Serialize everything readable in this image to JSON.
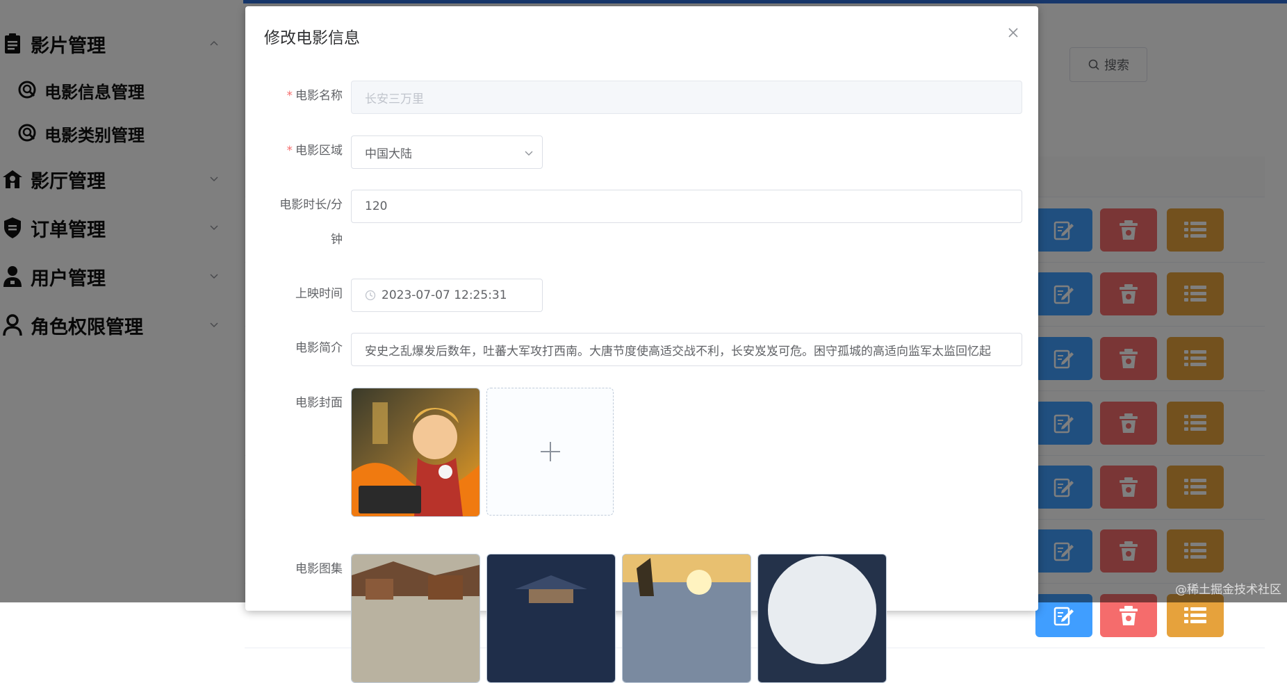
{
  "sidebar": {
    "menus": [
      {
        "label": "影片管理",
        "icon": "document-list-icon",
        "expanded": true
      },
      {
        "label": "影厅管理",
        "icon": "building-icon",
        "expanded": false
      },
      {
        "label": "订单管理",
        "icon": "shield-icon",
        "expanded": false
      },
      {
        "label": "用户管理",
        "icon": "user-badge-icon",
        "expanded": false
      },
      {
        "label": "角色权限管理",
        "icon": "user-icon",
        "expanded": false
      }
    ],
    "sub_items": [
      {
        "label": "电影信息管理",
        "icon": "search-circle-icon"
      },
      {
        "label": "电影类别管理",
        "icon": "search-circle-icon"
      }
    ]
  },
  "main": {
    "search_label": "搜索"
  },
  "dialog": {
    "title": "修改电影信息",
    "fields": {
      "name": {
        "label": "电影名称",
        "required": true,
        "value": "长安三万里"
      },
      "region": {
        "label": "电影区域",
        "required": true,
        "value": "中国大陆"
      },
      "duration": {
        "label_line1": "电影时长/分",
        "label_line2": "钟",
        "value": "120"
      },
      "release": {
        "label": "上映时间",
        "value": "2023-07-07 12:25:31"
      },
      "intro": {
        "label": "电影简介",
        "value": "安史之乱爆发后数年，吐蕃大军攻打西南。大唐节度使高适交战不利，长安岌岌可危。困守孤城的高适向监军太监回忆起"
      },
      "cover": {
        "label": "电影封面"
      },
      "gallery": {
        "label": "电影图集"
      }
    }
  },
  "watermark": "@稀土掘金技术社区",
  "colors": {
    "primary": "#409eff",
    "danger": "#f56c6c",
    "warning": "#e6a23c",
    "required": "#f56c6c"
  }
}
